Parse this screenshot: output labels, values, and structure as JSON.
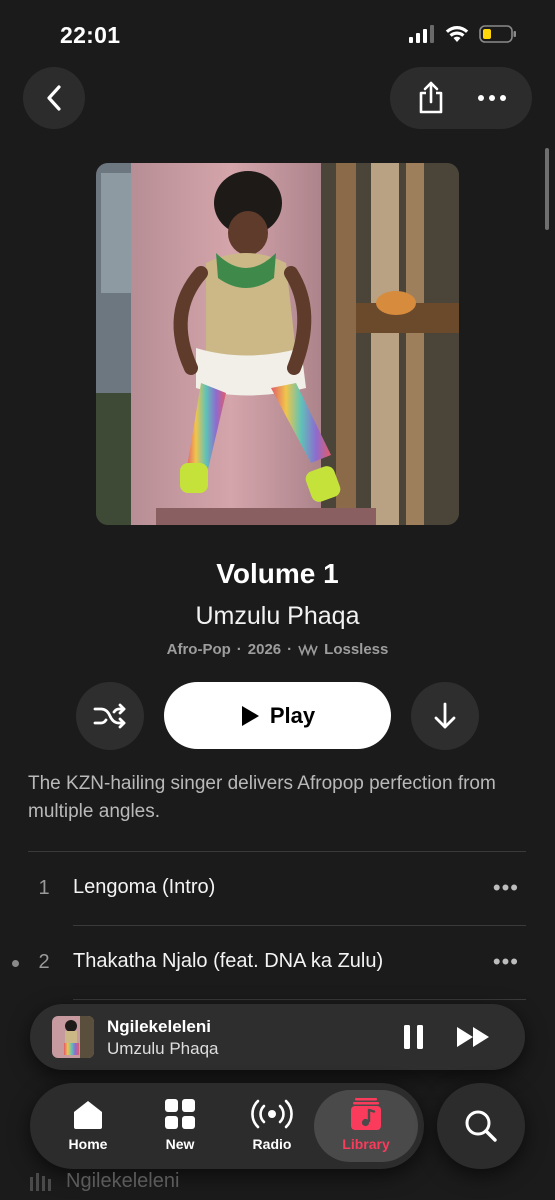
{
  "status": {
    "time": "22:01"
  },
  "album": {
    "title": "Volume 1",
    "artist": "Umzulu Phaqa",
    "genre": "Afro-Pop",
    "year": "2026",
    "quality": "Lossless",
    "description": "The KZN-hailing singer delivers Afropop perfection from multiple angles."
  },
  "actions": {
    "play_label": "Play"
  },
  "tracks": [
    {
      "number": "1",
      "title": "Lengoma (Intro)"
    },
    {
      "number": "2",
      "title": "Thakatha Njalo (feat. DNA ka Zulu)"
    }
  ],
  "partial_rows": {
    "row_bottom": "Ngilekeleleni"
  },
  "now_playing": {
    "title": "Ngilekeleleni",
    "artist": "Umzulu Phaqa"
  },
  "tabs": [
    {
      "label": "Home",
      "icon": "house-icon"
    },
    {
      "label": "New",
      "icon": "grid-icon"
    },
    {
      "label": "Radio",
      "icon": "broadcast-icon"
    },
    {
      "label": "Library",
      "icon": "music-library-icon",
      "active": true
    }
  ],
  "colors": {
    "accent": "#fa3b5c",
    "background": "#1b1b1b"
  }
}
